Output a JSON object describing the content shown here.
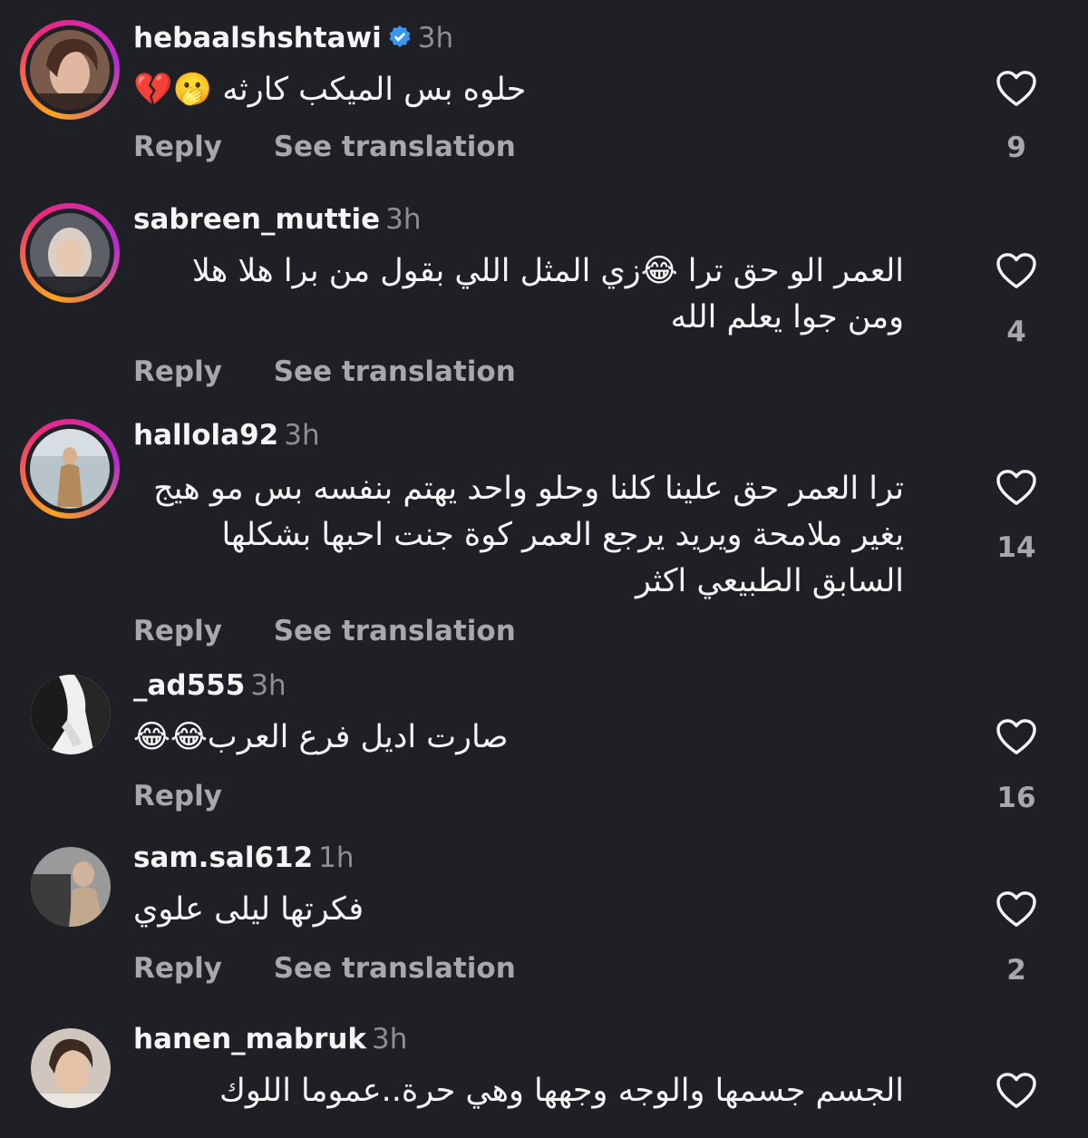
{
  "comments": [
    {
      "username": "hebaalshshtawi",
      "verified": true,
      "time": "3h",
      "text": "حلوه بس الميكب كارثه 🫢💔",
      "reply": "Reply",
      "translate": "See translation",
      "likes": "9",
      "avatar_icon": "avatar-photo"
    },
    {
      "username": "sabreen_muttie",
      "time": "3h",
      "text": "العمر الو حق ترا 😂زي المثل اللي بقول من برا هلا هلا ومن جوا يعلم الله",
      "reply": "Reply",
      "translate": "See translation",
      "likes": "4"
    },
    {
      "username": "hallola92",
      "time": "3h",
      "text": "ترا العمر حق علينا كلنا وحلو واحد يهتم بنفسه بس مو هيج يغير ملامحة ويريد يرجع العمر كوة جنت احبها بشكلها السابق الطبيعي اكثر",
      "reply": "Reply",
      "translate": "See translation",
      "likes": "14"
    },
    {
      "username": "_ad555",
      "time": "3h",
      "text": "صارت اديل فرع العرب😂😂",
      "reply": "Reply",
      "likes": "16"
    },
    {
      "username": "sam.sal612",
      "time": "1h",
      "text": "فكرتها ليلى علوي",
      "reply": "Reply",
      "translate": "See translation",
      "likes": "2"
    },
    {
      "username": "hanen_mabruk",
      "time": "3h",
      "text": "الجسم جسمها والوجه وجهها وهي حرة..عموما اللوك",
      "likes": ""
    }
  ],
  "colors": {
    "background": "#1f2026",
    "text": "#f5f5f5",
    "muted": "#a7a8ad",
    "verified": "#3897f0"
  }
}
